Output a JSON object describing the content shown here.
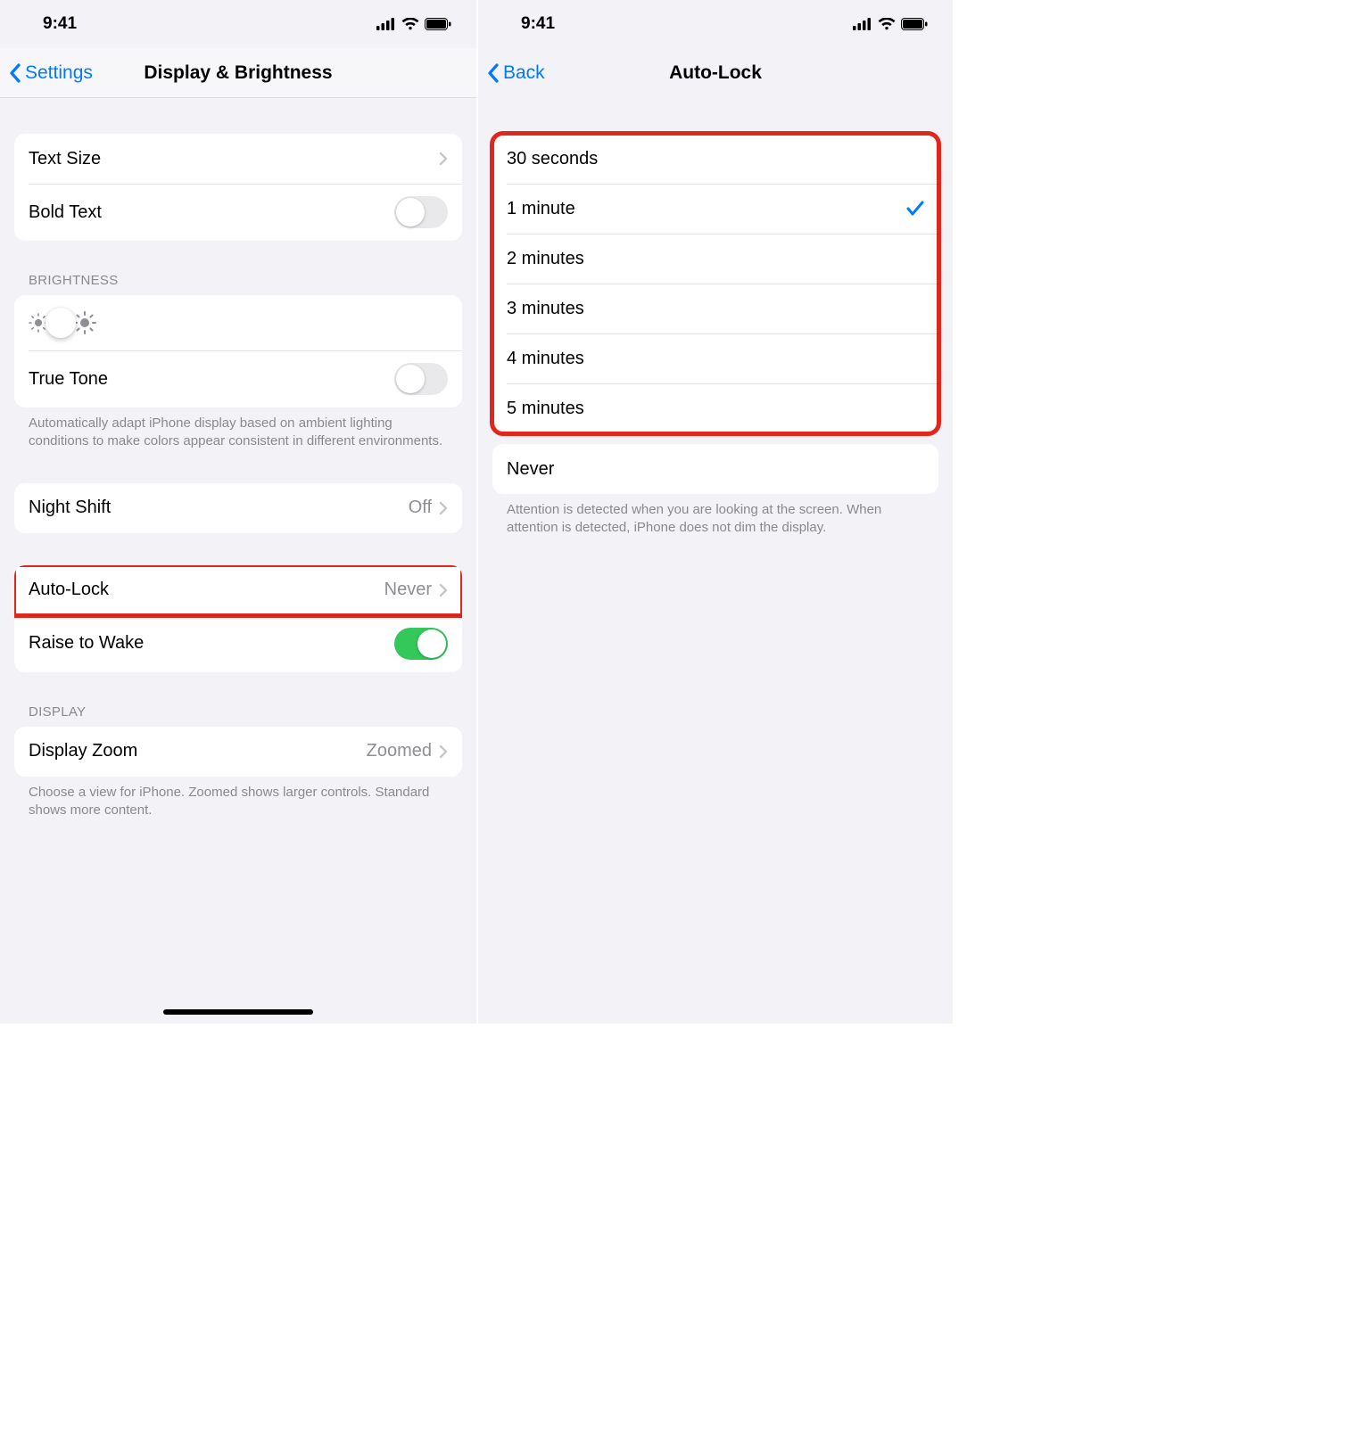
{
  "statusbar": {
    "time": "9:41"
  },
  "left": {
    "nav": {
      "back": "Settings",
      "title": "Display & Brightness"
    },
    "text_size_label": "Text Size",
    "bold_text_label": "Bold Text",
    "bold_text_on": false,
    "brightness_header": "BRIGHTNESS",
    "brightness_percent": 56,
    "true_tone_label": "True Tone",
    "true_tone_on": false,
    "true_tone_footer": "Automatically adapt iPhone display based on ambient lighting conditions to make colors appear consistent in different environments.",
    "night_shift_label": "Night Shift",
    "night_shift_value": "Off",
    "auto_lock_label": "Auto-Lock",
    "auto_lock_value": "Never",
    "raise_to_wake_label": "Raise to Wake",
    "raise_to_wake_on": true,
    "display_header": "DISPLAY",
    "display_zoom_label": "Display Zoom",
    "display_zoom_value": "Zoomed",
    "display_zoom_footer": "Choose a view for iPhone. Zoomed shows larger controls. Standard shows more content."
  },
  "right": {
    "nav": {
      "back": "Back",
      "title": "Auto-Lock"
    },
    "options": [
      {
        "label": "30 seconds",
        "selected": false
      },
      {
        "label": "1 minute",
        "selected": true
      },
      {
        "label": "2 minutes",
        "selected": false
      },
      {
        "label": "3 minutes",
        "selected": false
      },
      {
        "label": "4 minutes",
        "selected": false
      },
      {
        "label": "5 minutes",
        "selected": false
      },
      {
        "label": "Never",
        "selected": false
      }
    ],
    "footer": "Attention is detected when you are looking at the screen. When attention is detected, iPhone does not dim the display."
  }
}
